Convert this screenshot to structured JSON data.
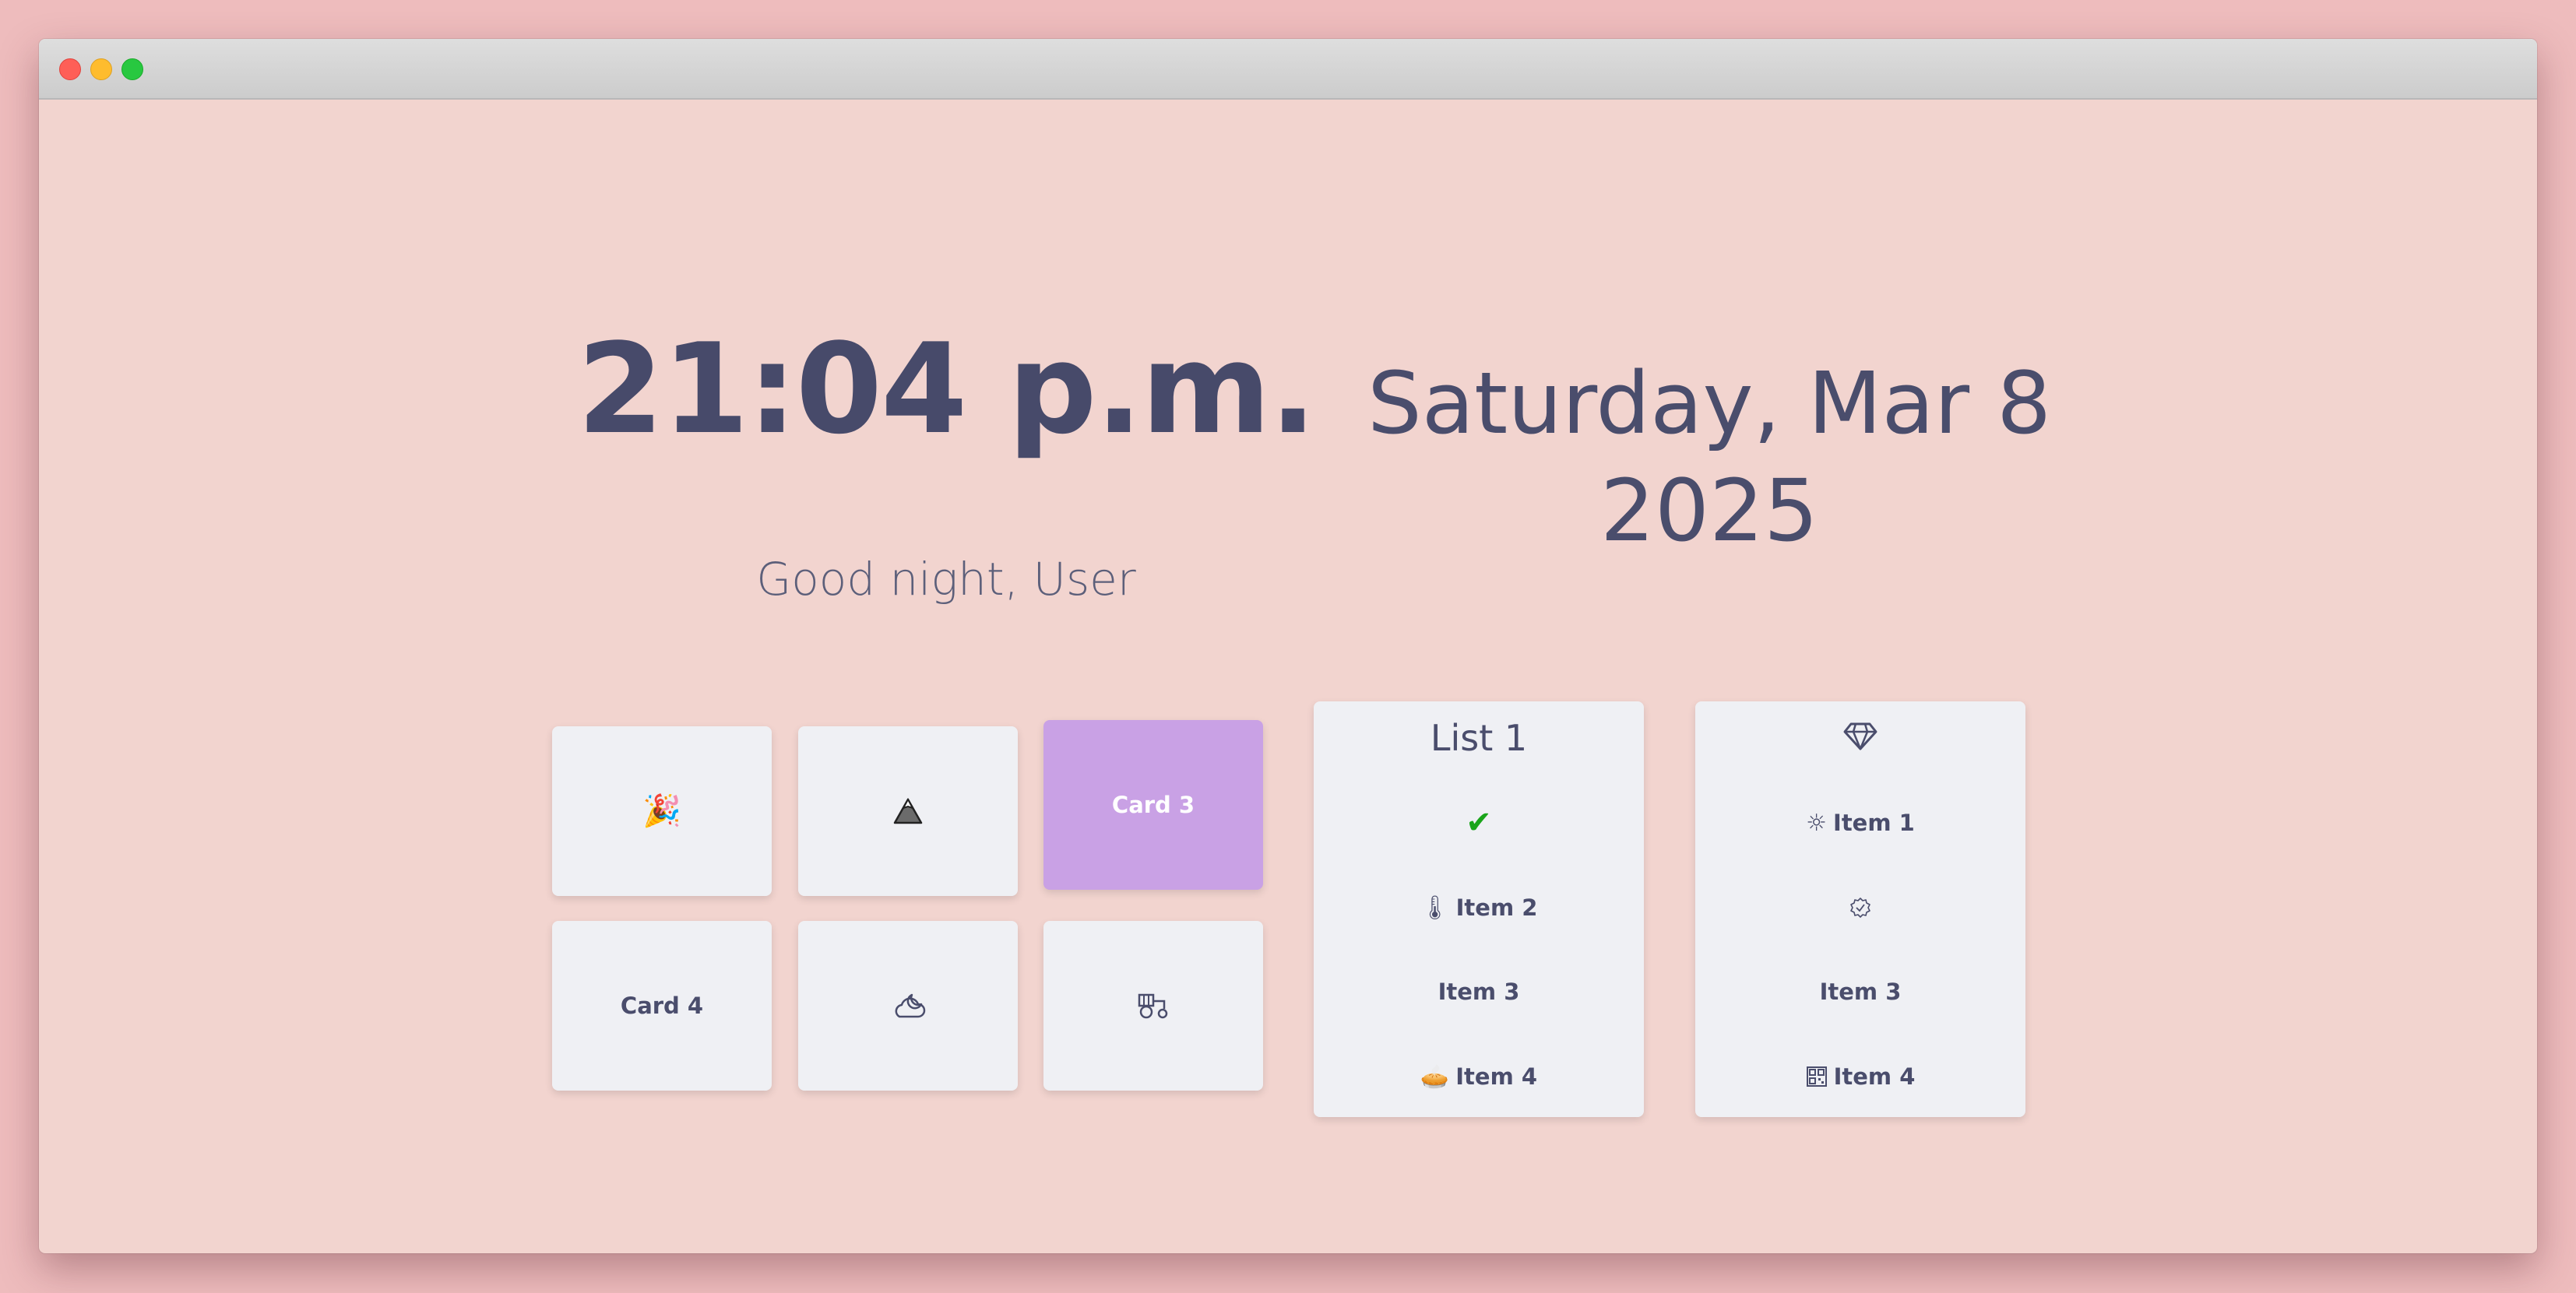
{
  "window": {
    "traffic_lights": [
      "close",
      "minimize",
      "maximize"
    ]
  },
  "clock": {
    "time": "21:04 p.m.",
    "greeting": "Good night, User"
  },
  "date": {
    "line1": "Saturday, Mar 8",
    "line2": "2025"
  },
  "cards": [
    {
      "label": "",
      "icon": "party-popper-icon",
      "glyph": "🎉"
    },
    {
      "label": "",
      "icon": "mountain-icon",
      "glyph": "▲"
    },
    {
      "label": "Card 3",
      "icon": "",
      "glyph": ""
    },
    {
      "label": "Card 4",
      "icon": "",
      "glyph": ""
    },
    {
      "label": "",
      "icon": "cloud-moon-icon",
      "glyph": "☁"
    },
    {
      "label": "",
      "icon": "tractor-icon",
      "glyph": "🚜"
    }
  ],
  "list1": {
    "title": "List 1",
    "items": [
      {
        "label": "",
        "icon": "check-mark-icon",
        "glyph": "✔"
      },
      {
        "label": "Item 2",
        "icon": "thermometer-icon",
        "glyph": "🌡"
      },
      {
        "label": "Item 3",
        "icon": "",
        "glyph": ""
      },
      {
        "label": "Item 4",
        "icon": "pie-icon",
        "glyph": "🥧"
      }
    ]
  },
  "list2": {
    "title_icon": "gem-icon",
    "items": [
      {
        "label": "Item 1",
        "icon": "sun-icon",
        "glyph": "☼"
      },
      {
        "label": "",
        "icon": "badge-check-icon",
        "glyph": "✓"
      },
      {
        "label": "Item 3",
        "icon": "",
        "glyph": ""
      },
      {
        "label": "Item 4",
        "icon": "qr-code-icon",
        "glyph": "▦"
      }
    ]
  },
  "colors": {
    "background": "#eebcbd",
    "window": "#f2d4cf",
    "card": "#eff0f4",
    "active_card": "#c9a1e5",
    "text": "#474a6a"
  }
}
